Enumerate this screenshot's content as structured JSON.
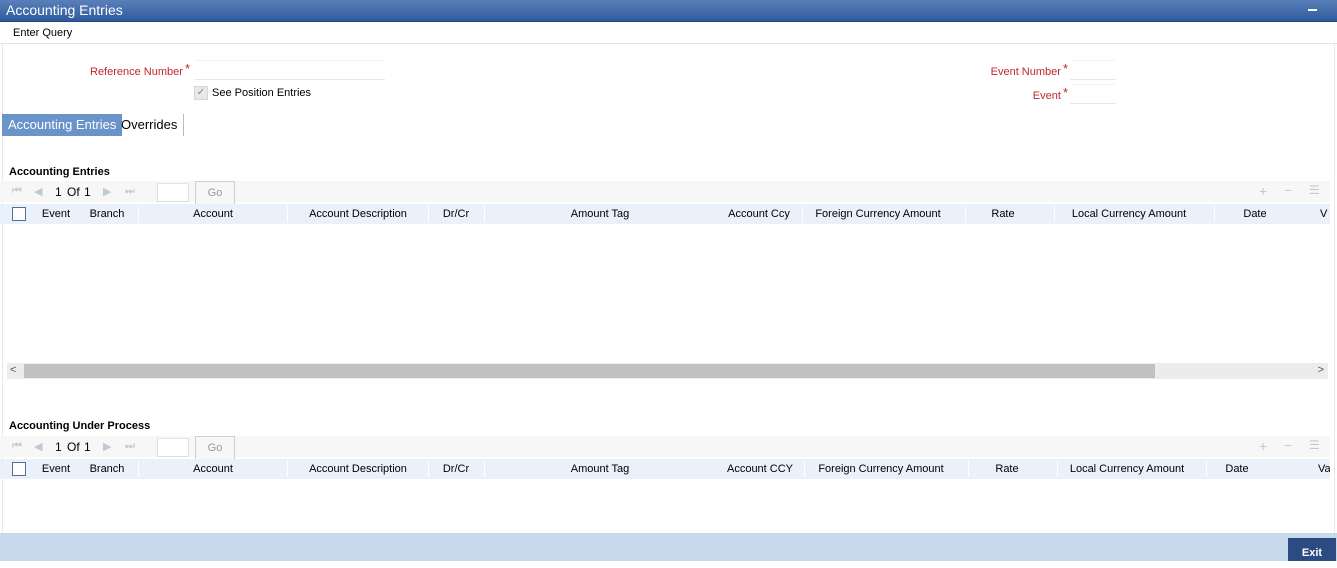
{
  "window": {
    "title": "Accounting Entries"
  },
  "toolbar": {
    "enter_query": "Enter Query"
  },
  "form": {
    "reference_number_label": "Reference Number",
    "see_position_label": "See Position Entries",
    "event_number_label": "Event Number",
    "event_label": "Event",
    "required_mark": "*"
  },
  "tabs": {
    "accounting": "Accounting Entries",
    "overrides": "Overrides"
  },
  "entries": {
    "title": "Accounting Entries",
    "pager": {
      "current": "1",
      "of_label": "Of",
      "total": "1",
      "go": "Go"
    },
    "columns": [
      "Event",
      "Branch",
      "Account",
      "Account Description",
      "Dr/Cr",
      "Amount Tag",
      "Account Ccy",
      "Foreign Currency Amount",
      "Rate",
      "Local Currency Amount",
      "Date",
      "V"
    ]
  },
  "under_process": {
    "title": "Accounting Under Process",
    "pager": {
      "current": "1",
      "of_label": "Of",
      "total": "1",
      "go": "Go"
    },
    "columns": [
      "Event",
      "Branch",
      "Account",
      "Account Description",
      "Dr/Cr",
      "Amount Tag",
      "Account CCY",
      "Foreign Currency Amount",
      "Rate",
      "Local Currency Amount",
      "Date",
      "Va"
    ]
  },
  "footer": {
    "exit": "Exit"
  }
}
